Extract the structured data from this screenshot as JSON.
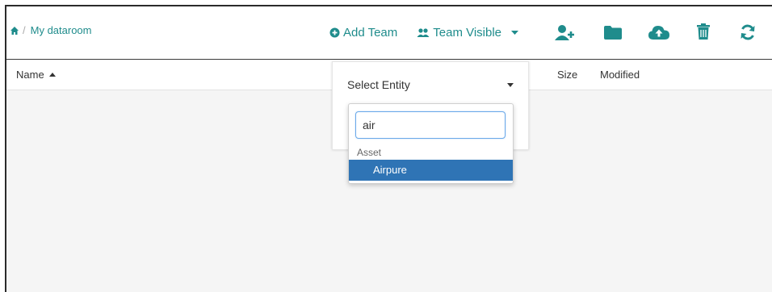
{
  "breadcrumb": {
    "home_icon": "home-icon",
    "separator": "/",
    "current": "My dataroom"
  },
  "toolbar": {
    "add_team": "Add Team",
    "team_visible": "Team Visible",
    "icons": [
      "add-user-icon",
      "folder-icon",
      "cloud-upload-icon",
      "trash-icon",
      "refresh-icon"
    ]
  },
  "table": {
    "columns": {
      "name": "Name",
      "size": "Size",
      "modified": "Modified"
    },
    "sort": "name ascending"
  },
  "entity": {
    "select_label": "Select Entity",
    "search_value": "air",
    "group_label": "Asset",
    "options": [
      "Airpure"
    ]
  },
  "colors": {
    "accent": "#1f8c8c",
    "selected_option": "#2f74b5",
    "search_focus": "#6aa9e9"
  }
}
